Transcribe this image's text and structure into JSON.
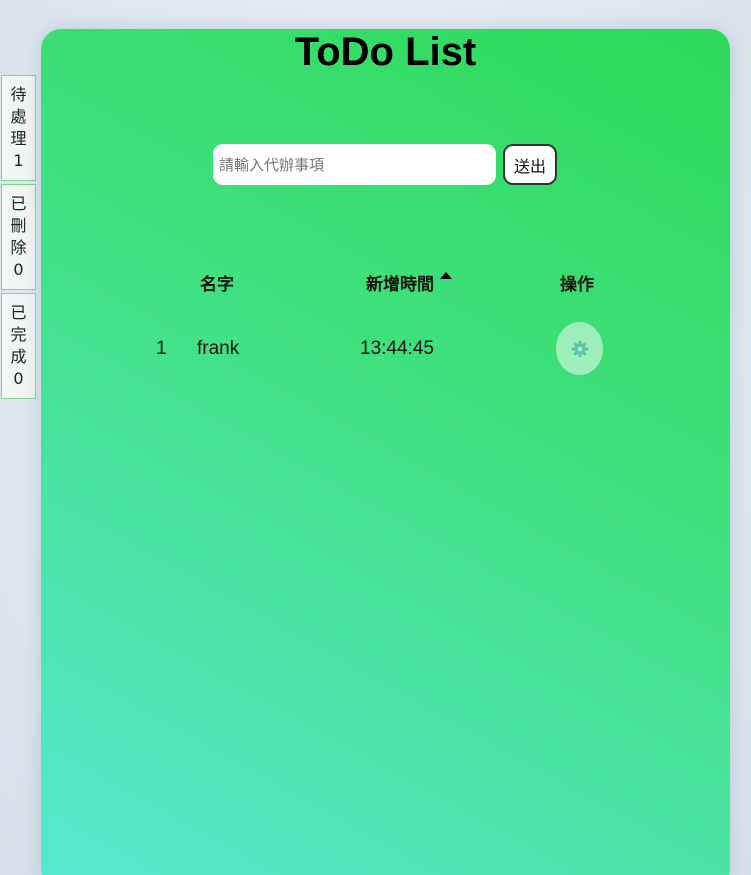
{
  "sidebar": {
    "tabs": [
      {
        "chars": [
          "待",
          "處",
          "理"
        ],
        "count": "1"
      },
      {
        "chars": [
          "已",
          "刪",
          "除"
        ],
        "count": "0"
      },
      {
        "chars": [
          "已",
          "完",
          "成"
        ],
        "count": "0"
      }
    ]
  },
  "main": {
    "title": "ToDo List",
    "input": {
      "value": "",
      "placeholder": "請輸入代辦事項"
    },
    "submit_label": "送出",
    "table": {
      "headers": {
        "name": "名字",
        "time": "新增時間",
        "action": "操作"
      },
      "sort": {
        "column": "time",
        "direction": "ascending"
      },
      "rows": [
        {
          "index": "1",
          "name": "frank",
          "time": "13:44:45",
          "action_icon": "gear-icon"
        }
      ]
    }
  },
  "colors": {
    "card_gradient_top": "#2dda58",
    "card_gradient_bottom": "#56e8d2",
    "tab_border": "#7fd68a",
    "gear_icon": "#5cc3a8"
  }
}
